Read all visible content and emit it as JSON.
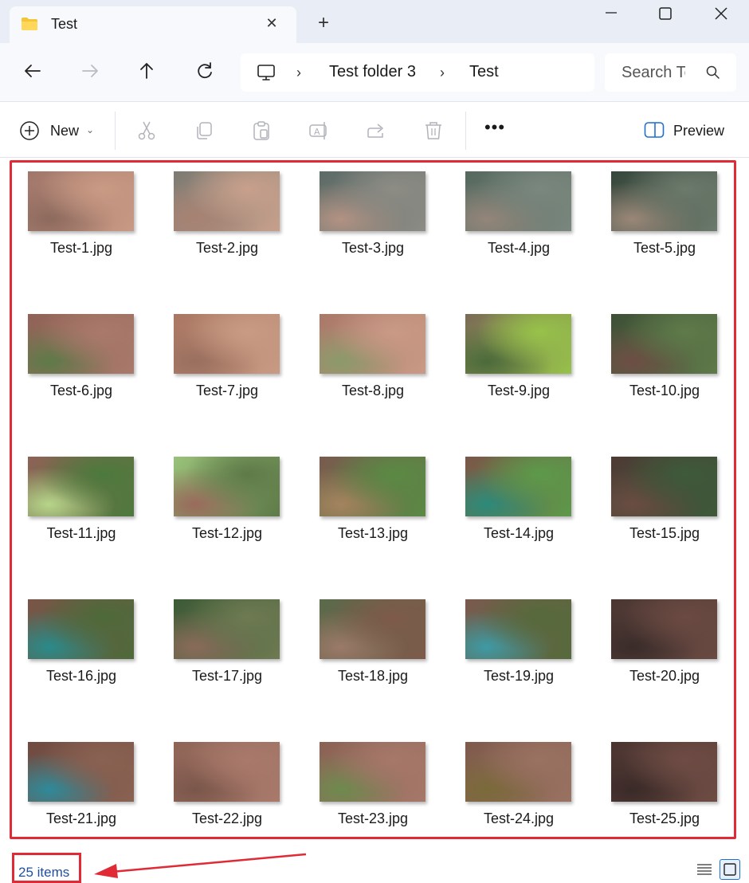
{
  "window": {
    "tab_title": "Test",
    "new_tab_label": "+"
  },
  "address_bar": {
    "breadcrumbs": [
      "Test folder 3",
      "Test"
    ],
    "search_placeholder": "Search Test"
  },
  "toolbar": {
    "new_label": "New",
    "more_label": "•••",
    "preview_label": "Preview"
  },
  "files": [
    {
      "name": "Test-1.jpg",
      "colors": [
        "#a0766a",
        "#c99a84",
        "#8d6a5e"
      ]
    },
    {
      "name": "Test-2.jpg",
      "colors": [
        "#7c7a72",
        "#c8a08c",
        "#a78272"
      ]
    },
    {
      "name": "Test-3.jpg",
      "colors": [
        "#5c6a66",
        "#8d8c85",
        "#b29283"
      ]
    },
    {
      "name": "Test-4.jpg",
      "colors": [
        "#56695e",
        "#7a877e",
        "#94857a"
      ]
    },
    {
      "name": "Test-5.jpg",
      "colors": [
        "#36463a",
        "#6c7a6c",
        "#9a8778"
      ]
    },
    {
      "name": "Test-6.jpg",
      "colors": [
        "#8e6256",
        "#a97a6b",
        "#5e7a48"
      ]
    },
    {
      "name": "Test-7.jpg",
      "colors": [
        "#a87662",
        "#c99b84",
        "#9a6f5e"
      ]
    },
    {
      "name": "Test-8.jpg",
      "colors": [
        "#a97868",
        "#c99a86",
        "#8b9a6a"
      ]
    },
    {
      "name": "Test-9.jpg",
      "colors": [
        "#7a6a56",
        "#97c24a",
        "#4b6a3a"
      ]
    },
    {
      "name": "Test-10.jpg",
      "colors": [
        "#3e4f36",
        "#5f7a4a",
        "#6e4e44"
      ]
    },
    {
      "name": "Test-11.jpg",
      "colors": [
        "#8e6256",
        "#4c7a3c",
        "#b7d58a"
      ]
    },
    {
      "name": "Test-12.jpg",
      "colors": [
        "#9ac27a",
        "#5e7a48",
        "#9a6a5c"
      ]
    },
    {
      "name": "Test-13.jpg",
      "colors": [
        "#7a5a4e",
        "#5a8a44",
        "#a4845e"
      ]
    },
    {
      "name": "Test-14.jpg",
      "colors": [
        "#7a5648",
        "#5c9a4a",
        "#2c8a7a"
      ]
    },
    {
      "name": "Test-15.jpg",
      "colors": [
        "#4e3a34",
        "#3e5a3a",
        "#6a4c42"
      ]
    },
    {
      "name": "Test-16.jpg",
      "colors": [
        "#7a5448",
        "#4e6a3a",
        "#2a8a8a"
      ]
    },
    {
      "name": "Test-17.jpg",
      "colors": [
        "#3c5a36",
        "#6e7a52",
        "#8a6a5a"
      ]
    },
    {
      "name": "Test-18.jpg",
      "colors": [
        "#5a6a4a",
        "#7e5a4a",
        "#9a7a68"
      ]
    },
    {
      "name": "Test-19.jpg",
      "colors": [
        "#7a5a4e",
        "#566a3c",
        "#3e9aa4"
      ]
    },
    {
      "name": "Test-20.jpg",
      "colors": [
        "#4a3632",
        "#6a4a42",
        "#3a2c2a"
      ]
    },
    {
      "name": "Test-21.jpg",
      "colors": [
        "#6e4a40",
        "#8a6252",
        "#2e8a9a"
      ]
    },
    {
      "name": "Test-22.jpg",
      "colors": [
        "#8e6456",
        "#a97a6c",
        "#7a564a"
      ]
    },
    {
      "name": "Test-23.jpg",
      "colors": [
        "#8a6254",
        "#a6786a",
        "#6e8a4e"
      ]
    },
    {
      "name": "Test-24.jpg",
      "colors": [
        "#7e5a4c",
        "#9a7262",
        "#7a6a3a"
      ]
    },
    {
      "name": "Test-25.jpg",
      "colors": [
        "#4a3430",
        "#6e4c44",
        "#3a2a28"
      ]
    }
  ],
  "status": {
    "item_count": "25 items"
  },
  "accent_colors": {
    "annotation_red": "#e02a35",
    "status_blue": "#1f4f9e"
  }
}
